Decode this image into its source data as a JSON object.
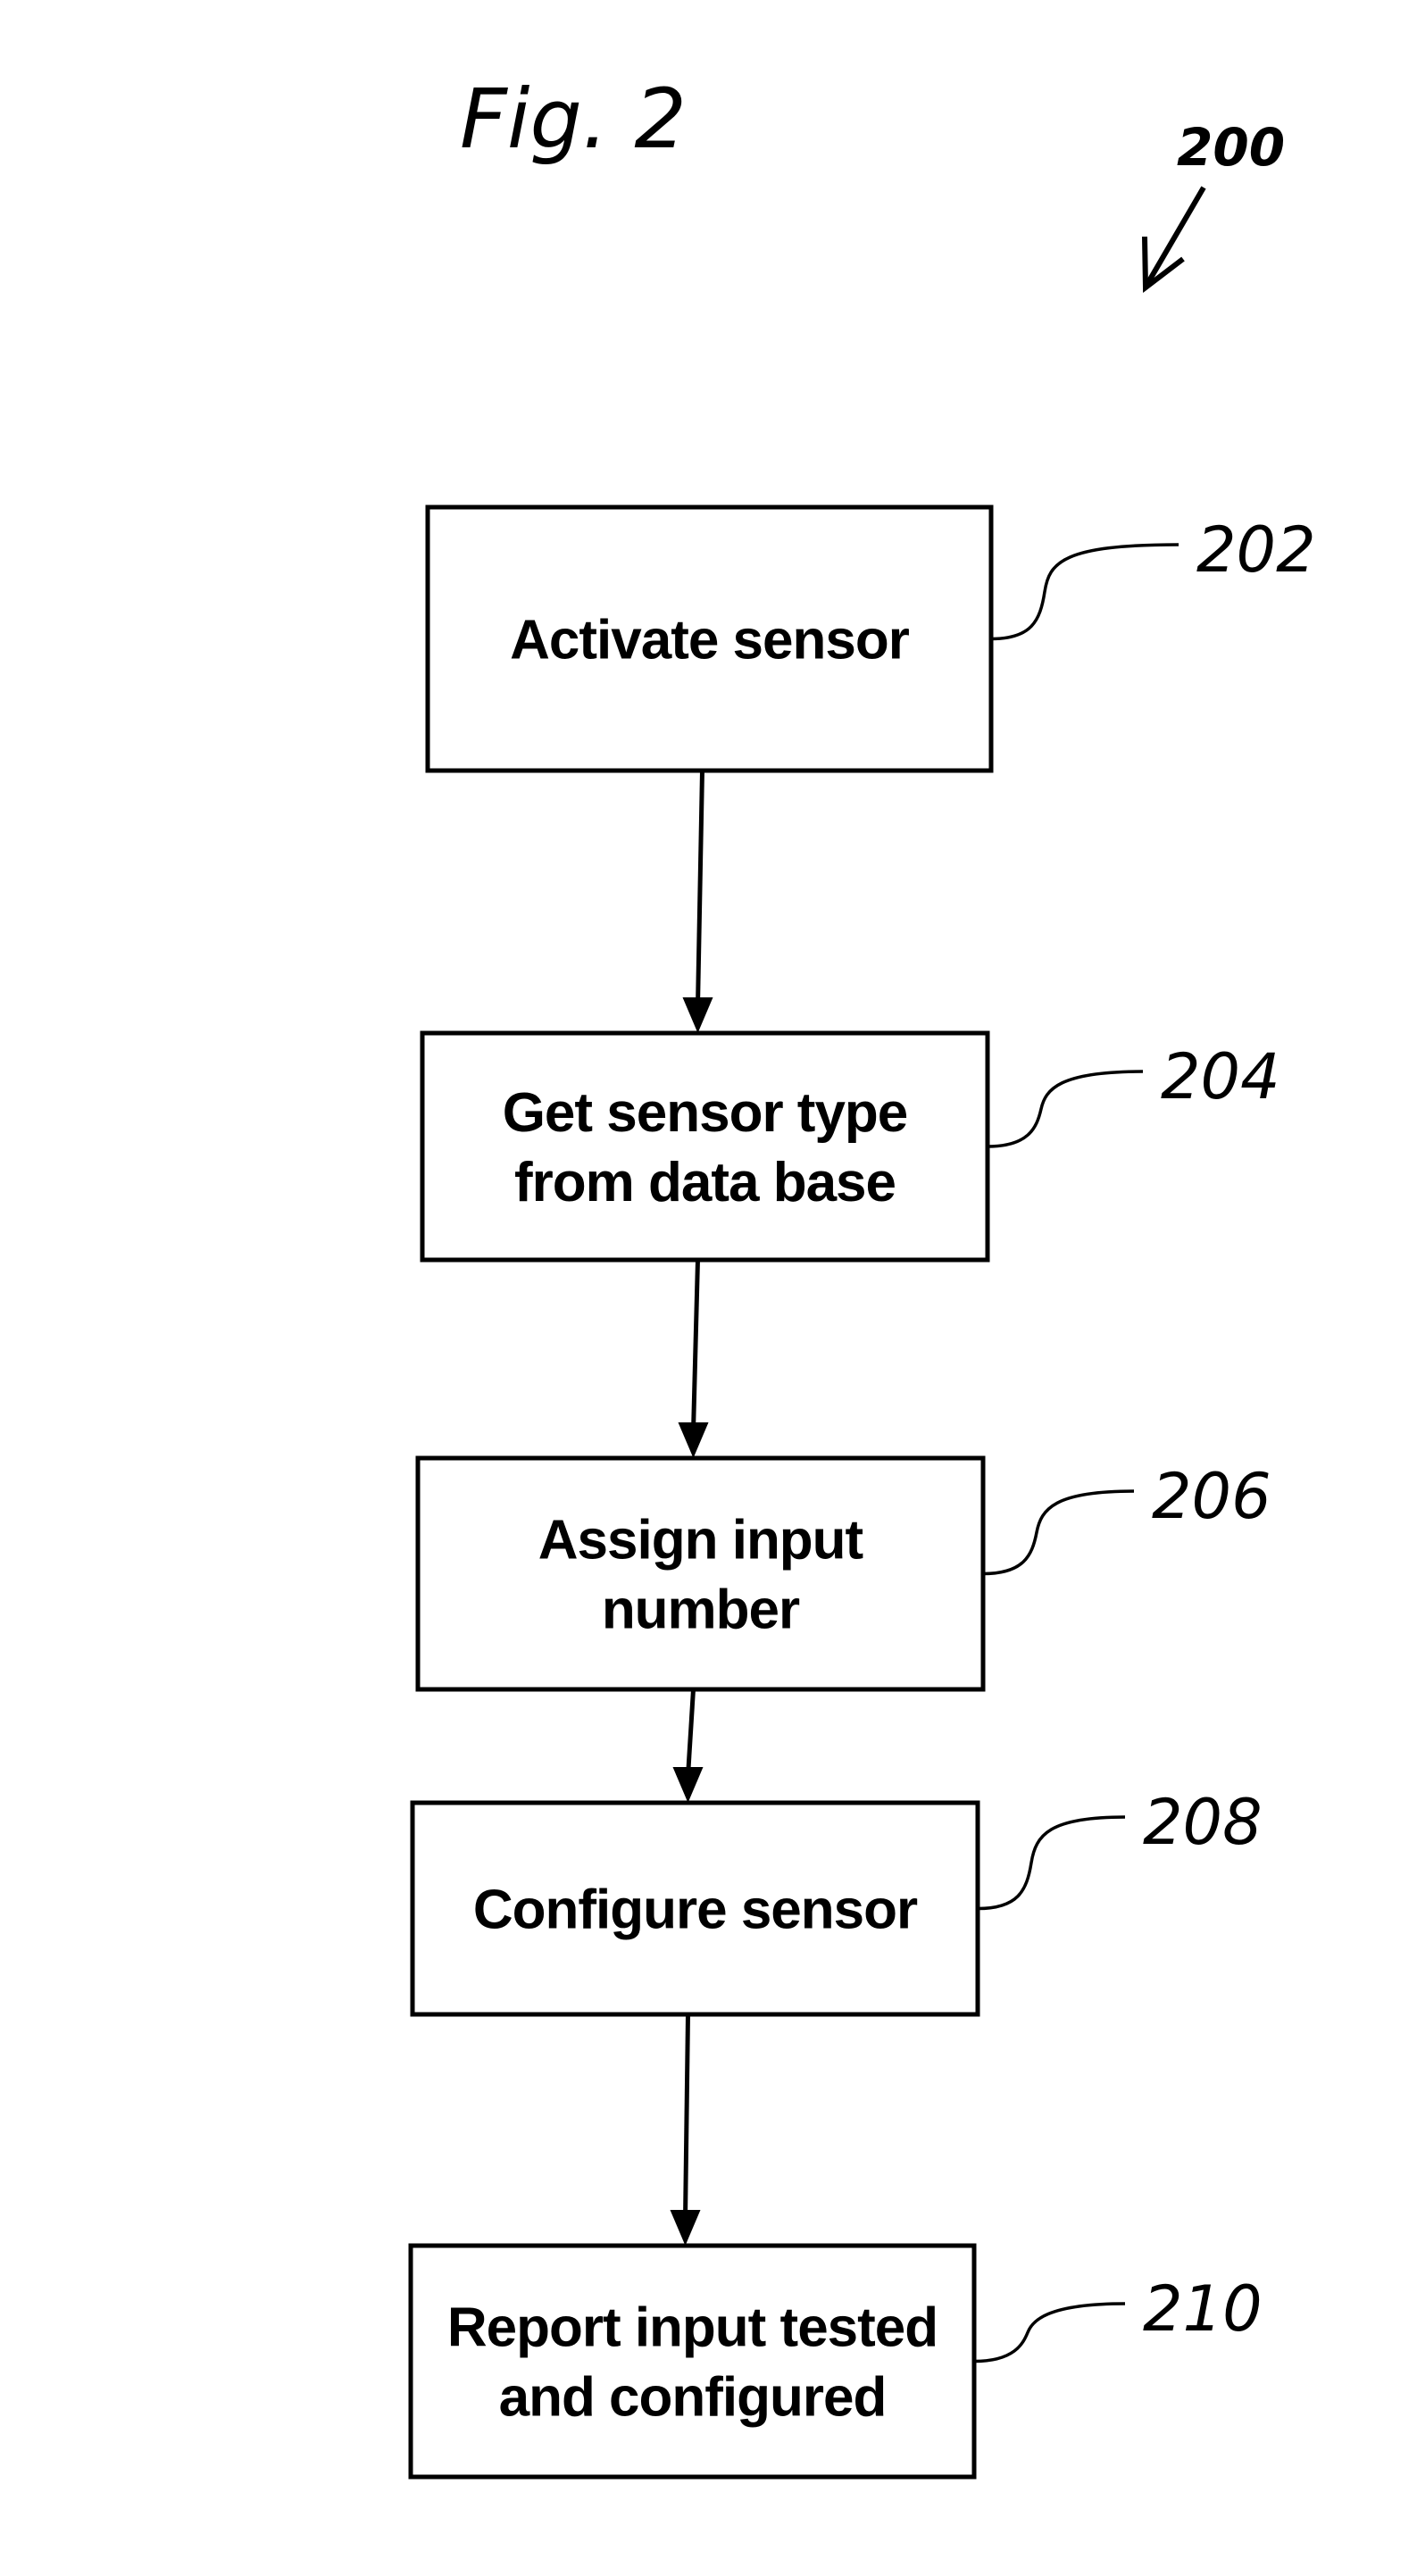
{
  "figure": {
    "title": "Fig. 2",
    "reference": "200"
  },
  "steps": [
    {
      "ref": "202",
      "lines": [
        "Activate sensor"
      ]
    },
    {
      "ref": "204",
      "lines": [
        "Get sensor type",
        "from data base"
      ]
    },
    {
      "ref": "206",
      "lines": [
        "Assign input",
        "number"
      ]
    },
    {
      "ref": "208",
      "lines": [
        "Configure sensor"
      ]
    },
    {
      "ref": "210",
      "lines": [
        "Report input tested",
        "and configured"
      ]
    }
  ],
  "colors": {
    "ink": "#000000",
    "paper": "#ffffff"
  }
}
